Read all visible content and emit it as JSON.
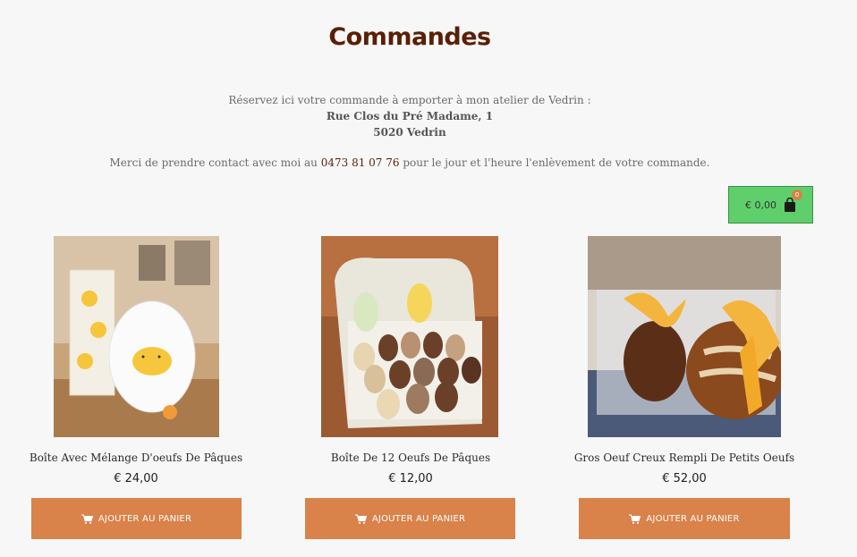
{
  "page": {
    "title": "Commandes",
    "intro_line": "Réservez ici votre commande à emporter à mon atelier de Vedrin :",
    "address_street": "Rue Clos du Pré Madame, 1",
    "address_city": "5020 Vedrin",
    "contact_before": "Merci de prendre contact avec moi au ",
    "contact_phone": "0473 81 07 76",
    "contact_after": " pour le jour et l'heure l'enlèvement de votre commande."
  },
  "cart": {
    "total": "€ 0,00",
    "count": "0",
    "icon": "shopping-bag-icon",
    "background_color": "#5fcf6c"
  },
  "products": [
    {
      "name": "Boîte Avec Mélange D'oeufs De Pâques",
      "price": "€ 24,00",
      "button_label": "AJOUTER AU PANIER"
    },
    {
      "name": "Boîte De 12 Oeufs De Pâques",
      "price": "€ 12,00",
      "button_label": "AJOUTER AU PANIER"
    },
    {
      "name": "Gros Oeuf Creux Rempli De Petits Oeufs",
      "price": "€ 52,00",
      "button_label": "AJOUTER AU PANIER"
    }
  ],
  "colors": {
    "title": "#5a1f05",
    "button": "#d9824a",
    "cart": "#5fcf6c"
  }
}
